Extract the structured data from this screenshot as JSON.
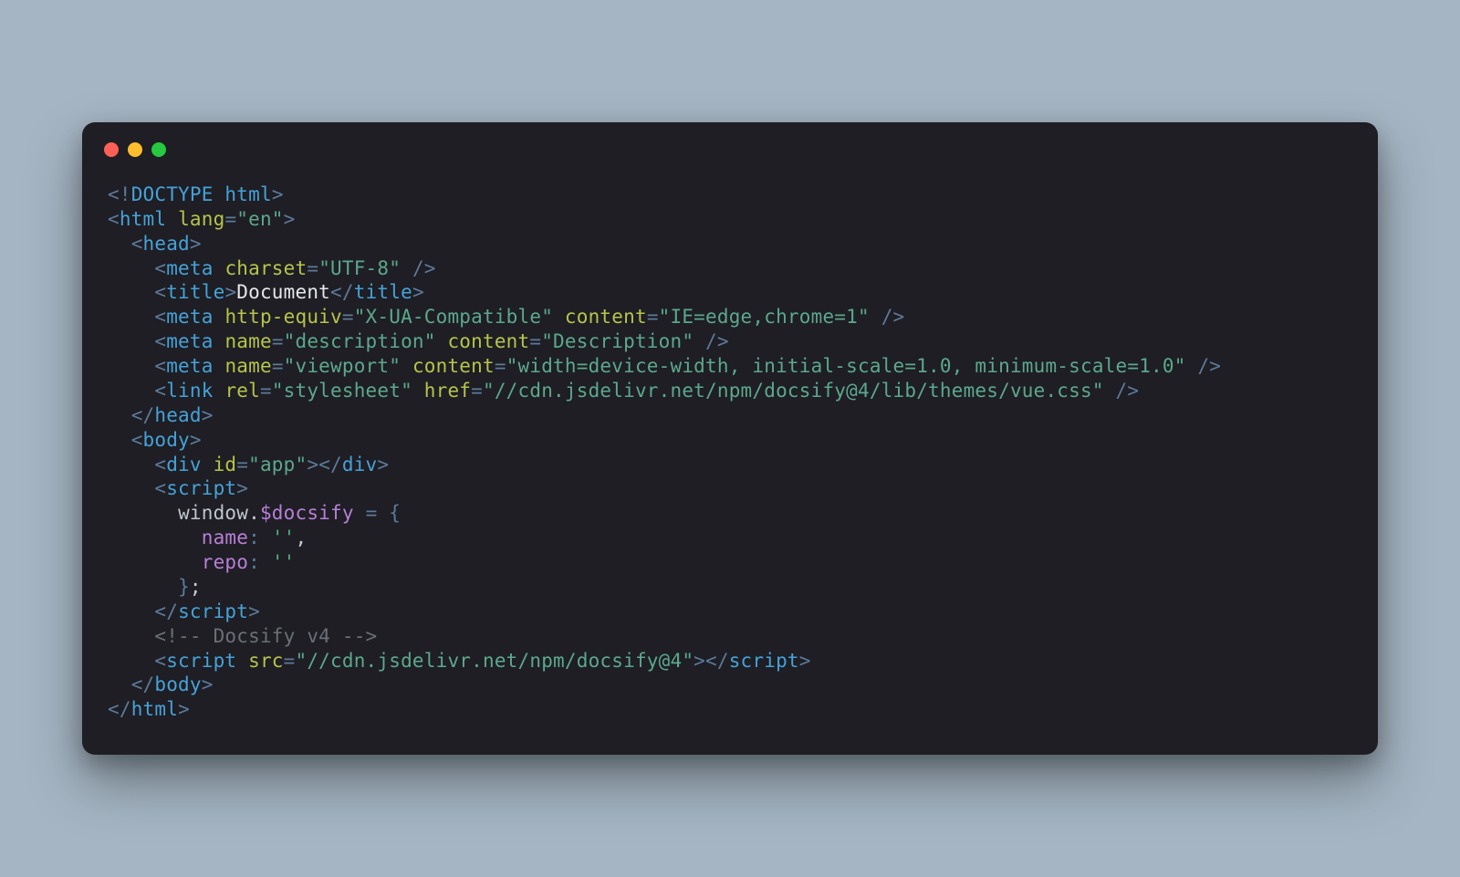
{
  "code": {
    "lines": [
      {
        "type": "tag-open",
        "indent": 0,
        "doctype": true,
        "parts": [
          {
            "k": "punc",
            "v": "<!"
          },
          {
            "k": "tag",
            "v": "DOCTYPE html"
          },
          {
            "k": "punc",
            "v": ">"
          }
        ]
      },
      {
        "type": "tag-open",
        "indent": 0,
        "parts": [
          {
            "k": "punc",
            "v": "<"
          },
          {
            "k": "tag",
            "v": "html"
          },
          {
            "k": "space",
            "v": " "
          },
          {
            "k": "attr",
            "v": "lang"
          },
          {
            "k": "punc",
            "v": "="
          },
          {
            "k": "str",
            "v": "\"en\""
          },
          {
            "k": "punc",
            "v": ">"
          }
        ]
      },
      {
        "type": "tag-open",
        "indent": 2,
        "parts": [
          {
            "k": "punc",
            "v": "<"
          },
          {
            "k": "tag",
            "v": "head"
          },
          {
            "k": "punc",
            "v": ">"
          }
        ]
      },
      {
        "type": "tag-self",
        "indent": 4,
        "parts": [
          {
            "k": "punc",
            "v": "<"
          },
          {
            "k": "tag",
            "v": "meta"
          },
          {
            "k": "space",
            "v": " "
          },
          {
            "k": "attr",
            "v": "charset"
          },
          {
            "k": "punc",
            "v": "="
          },
          {
            "k": "str",
            "v": "\"UTF-8\""
          },
          {
            "k": "space",
            "v": " "
          },
          {
            "k": "punc",
            "v": "/>"
          }
        ]
      },
      {
        "type": "tag-with-text",
        "indent": 4,
        "parts": [
          {
            "k": "punc",
            "v": "<"
          },
          {
            "k": "tag",
            "v": "title"
          },
          {
            "k": "punc",
            "v": ">"
          },
          {
            "k": "text",
            "v": "Document"
          },
          {
            "k": "punc",
            "v": "</"
          },
          {
            "k": "tag",
            "v": "title"
          },
          {
            "k": "punc",
            "v": ">"
          }
        ]
      },
      {
        "type": "tag-self",
        "indent": 4,
        "parts": [
          {
            "k": "punc",
            "v": "<"
          },
          {
            "k": "tag",
            "v": "meta"
          },
          {
            "k": "space",
            "v": " "
          },
          {
            "k": "attr",
            "v": "http-equiv"
          },
          {
            "k": "punc",
            "v": "="
          },
          {
            "k": "str",
            "v": "\"X-UA-Compatible\""
          },
          {
            "k": "space",
            "v": " "
          },
          {
            "k": "attr",
            "v": "content"
          },
          {
            "k": "punc",
            "v": "="
          },
          {
            "k": "str",
            "v": "\"IE=edge,chrome=1\""
          },
          {
            "k": "space",
            "v": " "
          },
          {
            "k": "punc",
            "v": "/>"
          }
        ]
      },
      {
        "type": "tag-self",
        "indent": 4,
        "parts": [
          {
            "k": "punc",
            "v": "<"
          },
          {
            "k": "tag",
            "v": "meta"
          },
          {
            "k": "space",
            "v": " "
          },
          {
            "k": "attr",
            "v": "name"
          },
          {
            "k": "punc",
            "v": "="
          },
          {
            "k": "str",
            "v": "\"description\""
          },
          {
            "k": "space",
            "v": " "
          },
          {
            "k": "attr",
            "v": "content"
          },
          {
            "k": "punc",
            "v": "="
          },
          {
            "k": "str",
            "v": "\"Description\""
          },
          {
            "k": "space",
            "v": " "
          },
          {
            "k": "punc",
            "v": "/>"
          }
        ]
      },
      {
        "type": "tag-self",
        "indent": 4,
        "parts": [
          {
            "k": "punc",
            "v": "<"
          },
          {
            "k": "tag",
            "v": "meta"
          },
          {
            "k": "space",
            "v": " "
          },
          {
            "k": "attr",
            "v": "name"
          },
          {
            "k": "punc",
            "v": "="
          },
          {
            "k": "str",
            "v": "\"viewport\""
          },
          {
            "k": "space",
            "v": " "
          },
          {
            "k": "attr",
            "v": "content"
          },
          {
            "k": "punc",
            "v": "="
          },
          {
            "k": "str",
            "v": "\"width=device-width, initial-scale=1.0, minimum-scale=1.0\""
          },
          {
            "k": "space",
            "v": " "
          },
          {
            "k": "punc",
            "v": "/>"
          }
        ]
      },
      {
        "type": "tag-self",
        "indent": 4,
        "parts": [
          {
            "k": "punc",
            "v": "<"
          },
          {
            "k": "tag",
            "v": "link"
          },
          {
            "k": "space",
            "v": " "
          },
          {
            "k": "attr",
            "v": "rel"
          },
          {
            "k": "punc",
            "v": "="
          },
          {
            "k": "str",
            "v": "\"stylesheet\""
          },
          {
            "k": "space",
            "v": " "
          },
          {
            "k": "attr",
            "v": "href"
          },
          {
            "k": "punc",
            "v": "="
          },
          {
            "k": "str",
            "v": "\"//cdn.jsdelivr.net/npm/docsify@4/lib/themes/vue.css\""
          },
          {
            "k": "space",
            "v": " "
          },
          {
            "k": "punc",
            "v": "/>"
          }
        ]
      },
      {
        "type": "tag-close",
        "indent": 2,
        "parts": [
          {
            "k": "punc",
            "v": "</"
          },
          {
            "k": "tag",
            "v": "head"
          },
          {
            "k": "punc",
            "v": ">"
          }
        ]
      },
      {
        "type": "tag-open",
        "indent": 2,
        "parts": [
          {
            "k": "punc",
            "v": "<"
          },
          {
            "k": "tag",
            "v": "body"
          },
          {
            "k": "punc",
            "v": ">"
          }
        ]
      },
      {
        "type": "tag-with-text",
        "indent": 4,
        "parts": [
          {
            "k": "punc",
            "v": "<"
          },
          {
            "k": "tag",
            "v": "div"
          },
          {
            "k": "space",
            "v": " "
          },
          {
            "k": "attr",
            "v": "id"
          },
          {
            "k": "punc",
            "v": "="
          },
          {
            "k": "str",
            "v": "\"app\""
          },
          {
            "k": "punc",
            "v": ">"
          },
          {
            "k": "punc",
            "v": "</"
          },
          {
            "k": "tag",
            "v": "div"
          },
          {
            "k": "punc",
            "v": ">"
          }
        ]
      },
      {
        "type": "tag-open",
        "indent": 4,
        "parts": [
          {
            "k": "punc",
            "v": "<"
          },
          {
            "k": "tag",
            "v": "script"
          },
          {
            "k": "punc",
            "v": ">"
          }
        ]
      },
      {
        "type": "js",
        "indent": 6,
        "parts": [
          {
            "k": "ident",
            "v": "window"
          },
          {
            "k": "js",
            "v": "."
          },
          {
            "k": "prop",
            "v": "$docsify"
          },
          {
            "k": "js",
            "v": " "
          },
          {
            "k": "punc",
            "v": "="
          },
          {
            "k": "js",
            "v": " "
          },
          {
            "k": "punc",
            "v": "{"
          }
        ]
      },
      {
        "type": "js",
        "indent": 8,
        "parts": [
          {
            "k": "key",
            "v": "name"
          },
          {
            "k": "punc",
            "v": ":"
          },
          {
            "k": "js",
            "v": " "
          },
          {
            "k": "quote",
            "v": "''"
          },
          {
            "k": "js",
            "v": ","
          }
        ]
      },
      {
        "type": "js",
        "indent": 8,
        "parts": [
          {
            "k": "key",
            "v": "repo"
          },
          {
            "k": "punc",
            "v": ":"
          },
          {
            "k": "js",
            "v": " "
          },
          {
            "k": "quote",
            "v": "''"
          }
        ]
      },
      {
        "type": "js",
        "indent": 6,
        "parts": [
          {
            "k": "punc",
            "v": "}"
          },
          {
            "k": "js",
            "v": ";"
          }
        ]
      },
      {
        "type": "tag-close",
        "indent": 4,
        "parts": [
          {
            "k": "punc",
            "v": "</"
          },
          {
            "k": "tag",
            "v": "script"
          },
          {
            "k": "punc",
            "v": ">"
          }
        ]
      },
      {
        "type": "comment",
        "indent": 4,
        "parts": [
          {
            "k": "comment",
            "v": "<!-- Docsify v4 -->"
          }
        ]
      },
      {
        "type": "tag-with-text",
        "indent": 4,
        "parts": [
          {
            "k": "punc",
            "v": "<"
          },
          {
            "k": "tag",
            "v": "script"
          },
          {
            "k": "space",
            "v": " "
          },
          {
            "k": "attr",
            "v": "src"
          },
          {
            "k": "punc",
            "v": "="
          },
          {
            "k": "str",
            "v": "\"//cdn.jsdelivr.net/npm/docsify@4\""
          },
          {
            "k": "punc",
            "v": ">"
          },
          {
            "k": "punc",
            "v": "</"
          },
          {
            "k": "tag",
            "v": "script"
          },
          {
            "k": "punc",
            "v": ">"
          }
        ]
      },
      {
        "type": "tag-close",
        "indent": 2,
        "parts": [
          {
            "k": "punc",
            "v": "</"
          },
          {
            "k": "tag",
            "v": "body"
          },
          {
            "k": "punc",
            "v": ">"
          }
        ]
      },
      {
        "type": "tag-close",
        "indent": 0,
        "parts": [
          {
            "k": "punc",
            "v": "</"
          },
          {
            "k": "tag",
            "v": "html"
          },
          {
            "k": "punc",
            "v": ">"
          }
        ]
      }
    ]
  },
  "window": {
    "traffic_lights": [
      "close",
      "minimize",
      "maximize"
    ]
  }
}
